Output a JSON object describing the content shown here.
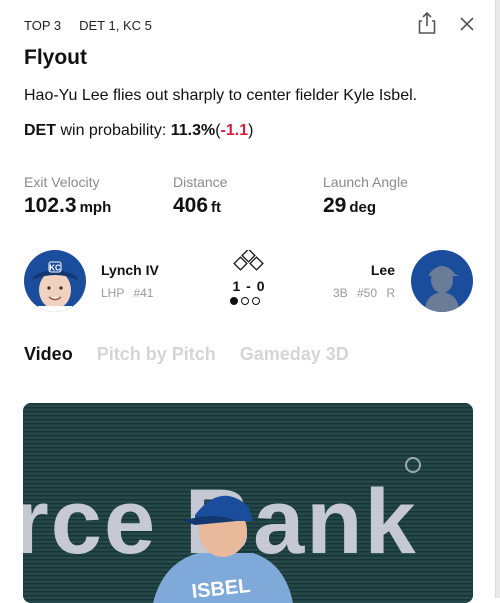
{
  "header": {
    "inning": "TOP 3",
    "score": "DET 1, KC 5"
  },
  "play": {
    "title": "Flyout",
    "description": "Hao-Yu Lee flies out sharply to center fielder Kyle Isbel.",
    "win_prob": {
      "team": "DET",
      "label": "win probability:",
      "value": "11.3%",
      "open": "(",
      "delta": "-1.1",
      "close": ")"
    }
  },
  "stats": {
    "exit_velocity": {
      "label": "Exit Velocity",
      "value": "102.3",
      "unit": "mph"
    },
    "distance": {
      "label": "Distance",
      "value": "406",
      "unit": "ft"
    },
    "launch_angle": {
      "label": "Launch Angle",
      "value": "29",
      "unit": "deg"
    }
  },
  "matchup": {
    "pitcher": {
      "name": "Lynch IV",
      "meta": "LHP #41",
      "cap_logo": "KC"
    },
    "batter": {
      "name": "Lee",
      "meta": "3B #50 R"
    },
    "count": "1 - 0",
    "outs_filled": 1,
    "outs_total": 3
  },
  "tabs": [
    {
      "label": "Video",
      "active": true
    },
    {
      "label": "Pitch by Pitch",
      "active": false
    },
    {
      "label": "Gameday 3D",
      "active": false
    }
  ],
  "video": {
    "scoreboard_text": "rce Bank",
    "jersey_name": "ISBEL"
  },
  "colors": {
    "delta_red": "#d6213a",
    "royals_blue": "#1a4d9c",
    "video_bg": "#1f3b3d"
  },
  "icons": [
    "share-icon",
    "close-icon"
  ]
}
